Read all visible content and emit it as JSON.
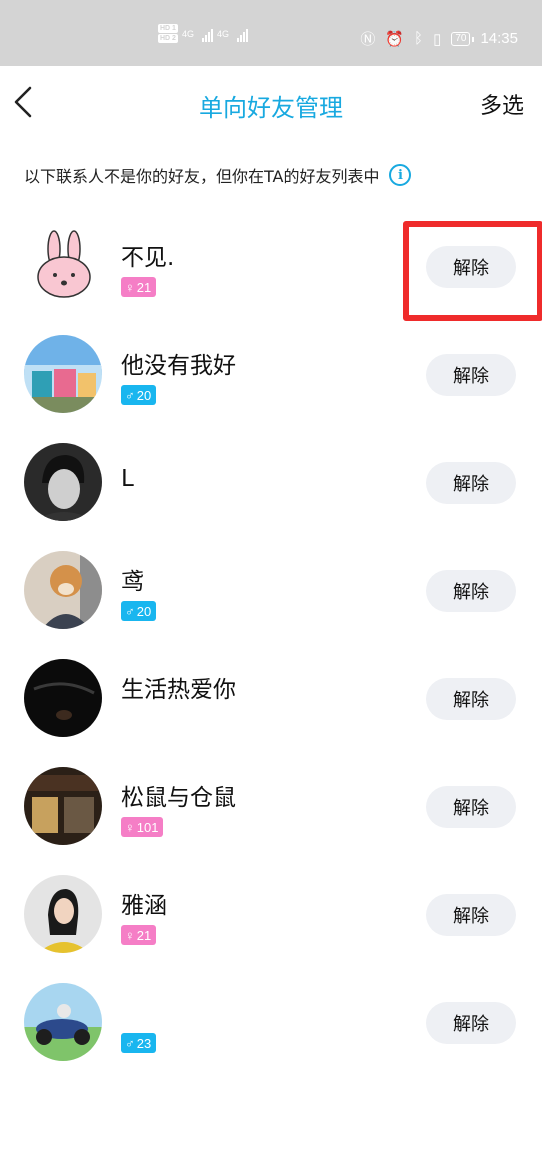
{
  "status_bar": {
    "network": [
      "HD 1",
      "HD 2"
    ],
    "signal_labels": [
      "4G",
      "4G"
    ],
    "battery": "70",
    "time": "14:35"
  },
  "header": {
    "back_icon": "chevron-left-icon",
    "title": "单向好友管理",
    "multi_select": "多选"
  },
  "notice": {
    "text": "以下联系人不是你的好友，但你在TA的好友列表中",
    "icon": "info-icon"
  },
  "contacts": [
    {
      "name": "不见.",
      "gender": "female",
      "gender_symbol": "♀",
      "age": "21",
      "button": "解除"
    },
    {
      "name": "他没有我好",
      "gender": "male",
      "gender_symbol": "♂",
      "age": "20",
      "button": "解除"
    },
    {
      "name": "L",
      "gender": null,
      "age": null,
      "button": "解除"
    },
    {
      "name": "鸢",
      "gender": "male",
      "gender_symbol": "♂",
      "age": "20",
      "button": "解除"
    },
    {
      "name": "生活热爱你",
      "gender": null,
      "age": null,
      "button": "解除"
    },
    {
      "name": "松鼠与仓鼠",
      "gender": "female",
      "gender_symbol": "♀",
      "age": "101",
      "button": "解除"
    },
    {
      "name": "雅涵",
      "gender": "female",
      "gender_symbol": "♀",
      "age": "21",
      "button": "解除"
    },
    {
      "name": "",
      "gender": "male",
      "gender_symbol": "♂",
      "age": "23",
      "button": "解除"
    }
  ],
  "colors": {
    "accent": "#18a9e0",
    "female_badge": "#f57ec6",
    "male_badge": "#19b6ef",
    "highlight": "#ef2b2b",
    "button_bg": "#eef0f4"
  }
}
